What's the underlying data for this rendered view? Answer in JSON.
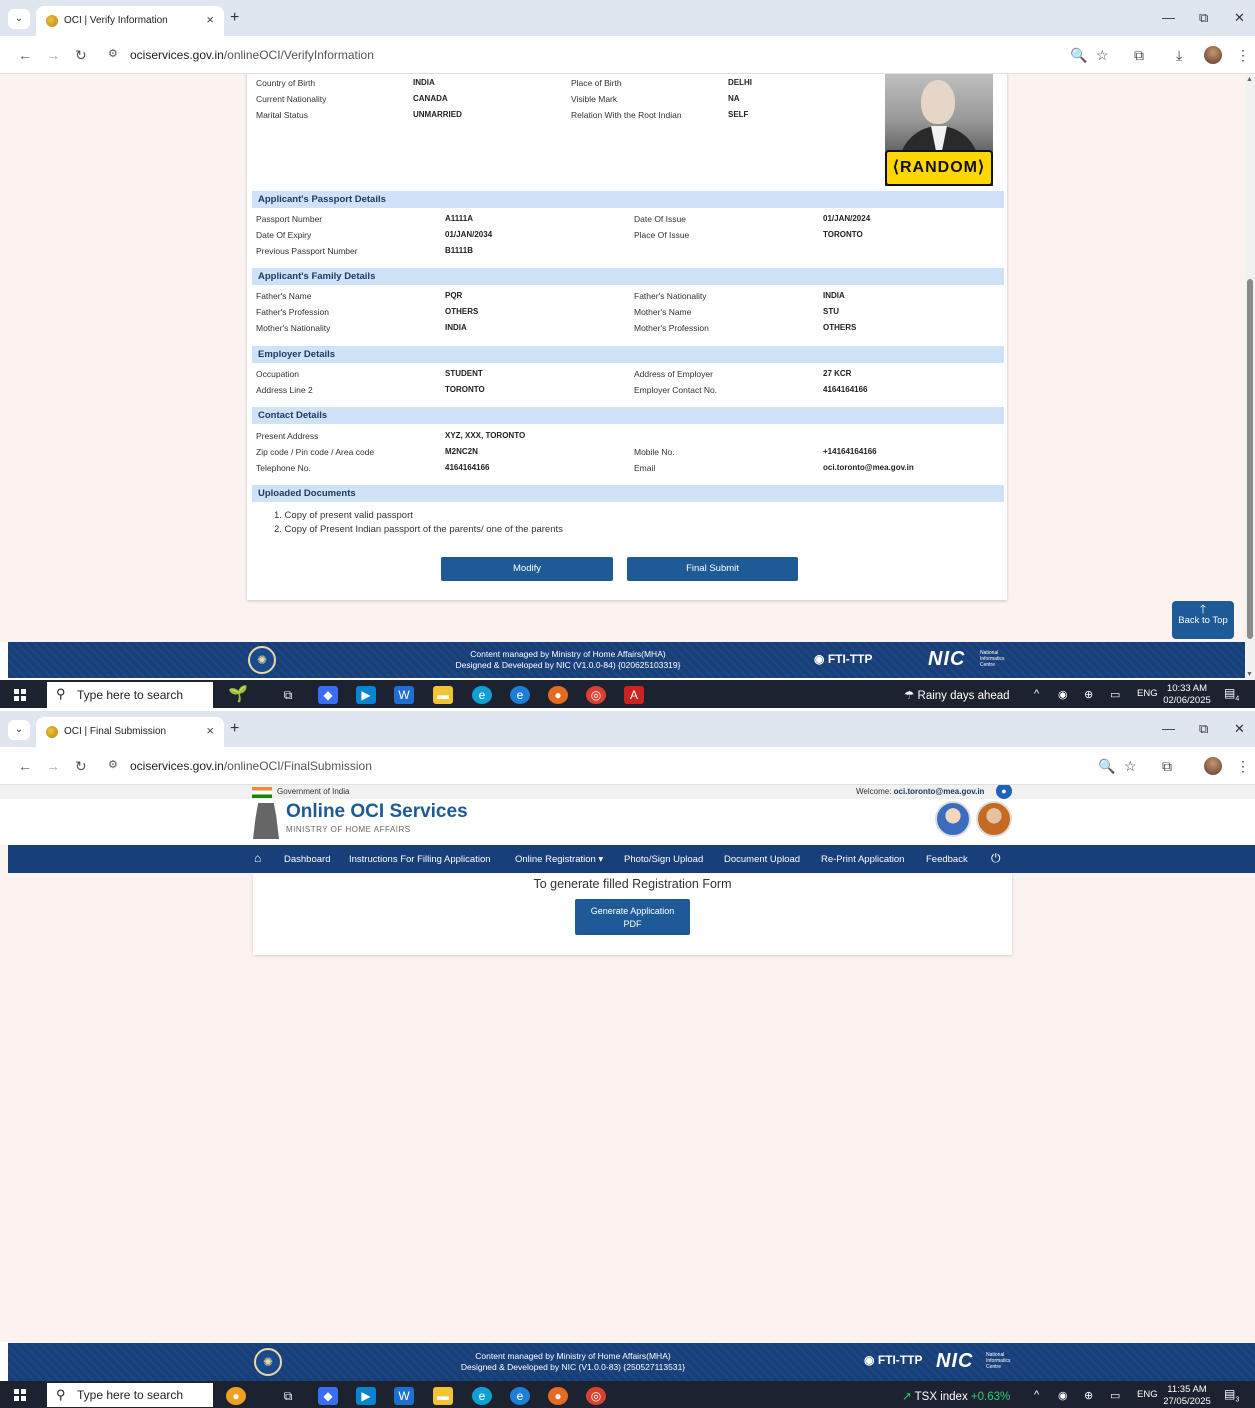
{
  "screen1": {
    "tab_title": "OCI | Verify Information",
    "url_host": "ociservices.gov.in",
    "url_path": "/onlineOCI/VerifyInformation",
    "personal": [
      {
        "label": "Country of Birth",
        "value": "INDIA",
        "label2": "Place of Birth",
        "value2": "DELHI"
      },
      {
        "label": "Current Nationality",
        "value": "CANADA",
        "label2": "Visible Mark",
        "value2": "NA"
      },
      {
        "label": "Marital Status",
        "value": "UNMARRIED",
        "label2": "Relation With the Root Indian",
        "value2": "SELF"
      }
    ],
    "photo_badge": "RANDOM",
    "passport_header": "Applicant's Passport Details",
    "passport": [
      {
        "label": "Passport Number",
        "value": "A1111A",
        "label2": "Date Of Issue",
        "value2": "01/JAN/2024"
      },
      {
        "label": "Date Of Expiry",
        "value": "01/JAN/2034",
        "label2": "Place Of Issue",
        "value2": "TORONTO"
      },
      {
        "label": "Previous Passport Number",
        "value": "B1111B",
        "label2": "",
        "value2": ""
      }
    ],
    "family_header": "Applicant's Family Details",
    "family": [
      {
        "label": "Father's Name",
        "value": "PQR",
        "label2": "Father's Nationality",
        "value2": "INDIA"
      },
      {
        "label": "Father's Profession",
        "value": "OTHERS",
        "label2": "Mother's Name",
        "value2": "STU"
      },
      {
        "label": "Mother's Nationality",
        "value": "INDIA",
        "label2": "Mother's Profession",
        "value2": "OTHERS"
      }
    ],
    "employer_header": "Employer Details",
    "employer": [
      {
        "label": "Occupation",
        "value": "STUDENT",
        "label2": "Address of Employer",
        "value2": "27 KCR"
      },
      {
        "label": "Address Line 2",
        "value": "TORONTO",
        "label2": "Employer Contact No.",
        "value2": "4164164166"
      }
    ],
    "contact_header": "Contact Details",
    "contact": [
      {
        "label": "Present Address",
        "value": "XYZ, XXX, TORONTO",
        "label2": "",
        "value2": ""
      },
      {
        "label": "Zip code / Pin code / Area code",
        "value": "M2NC2N",
        "label2": "Mobile No.",
        "value2": "+14164164166"
      },
      {
        "label": "Telephone No.",
        "value": "4164164166",
        "label2": "Email",
        "value2": "oci.toronto@mea.gov.in"
      }
    ],
    "docs_header": "Uploaded Documents",
    "docs": [
      "1. Copy of present valid passport",
      "2. Copy of Present Indian passport of the parents/ one of the parents"
    ],
    "modify_label": "Modify",
    "final_submit_label": "Final Submit",
    "back_to_top": "Back to Top",
    "footer_line1": "Content managed by Ministry of Home Affairs(MHA)",
    "footer_line2": "Designed & Developed by NIC (V1.0.0-84) {020625103319}",
    "taskbar_weather": "Rainy days ahead",
    "clock_time": "10:33 AM",
    "clock_date": "02/06/2025",
    "notif_count": "4"
  },
  "screen2": {
    "tab_title": "OCI | Final Submission",
    "url_host": "ociservices.gov.in",
    "url_path": "/onlineOCI/FinalSubmission",
    "gov_label": "Government of India",
    "welcome_label": "Welcome:",
    "welcome_user": "oci.toronto@mea.gov.in",
    "brand_title": "Online OCI Services",
    "brand_sub": "MINISTRY OF HOME AFFAIRS",
    "nav": [
      "Dashboard",
      "Instructions For Filling Application",
      "Online Registration ▾",
      "Photo/Sign Upload",
      "Document Upload",
      "Re-Print Application",
      "Feedback"
    ],
    "message": "To generate filled Registration Form",
    "generate_label_1": "Generate Application",
    "generate_label_2": "PDF",
    "footer_line1": "Content managed by Ministry of Home Affairs(MHA)",
    "footer_line2": "Designed & Developed by NIC (V1.0.0-83) {250527113531}",
    "taskbar_ticker": "TSX index",
    "taskbar_ticker_change": "+0.63%",
    "clock_time": "11:35 AM",
    "clock_date": "27/05/2025",
    "notif_count": "3"
  },
  "common": {
    "taskbar_search_placeholder": "Type here to search",
    "lang": "ENG",
    "fti_ttp": "FTI-TTP",
    "nic": "NIC",
    "nic_sub": "National Informatics Centre",
    "accent": "#1e5a96",
    "navy": "#173f7a"
  }
}
